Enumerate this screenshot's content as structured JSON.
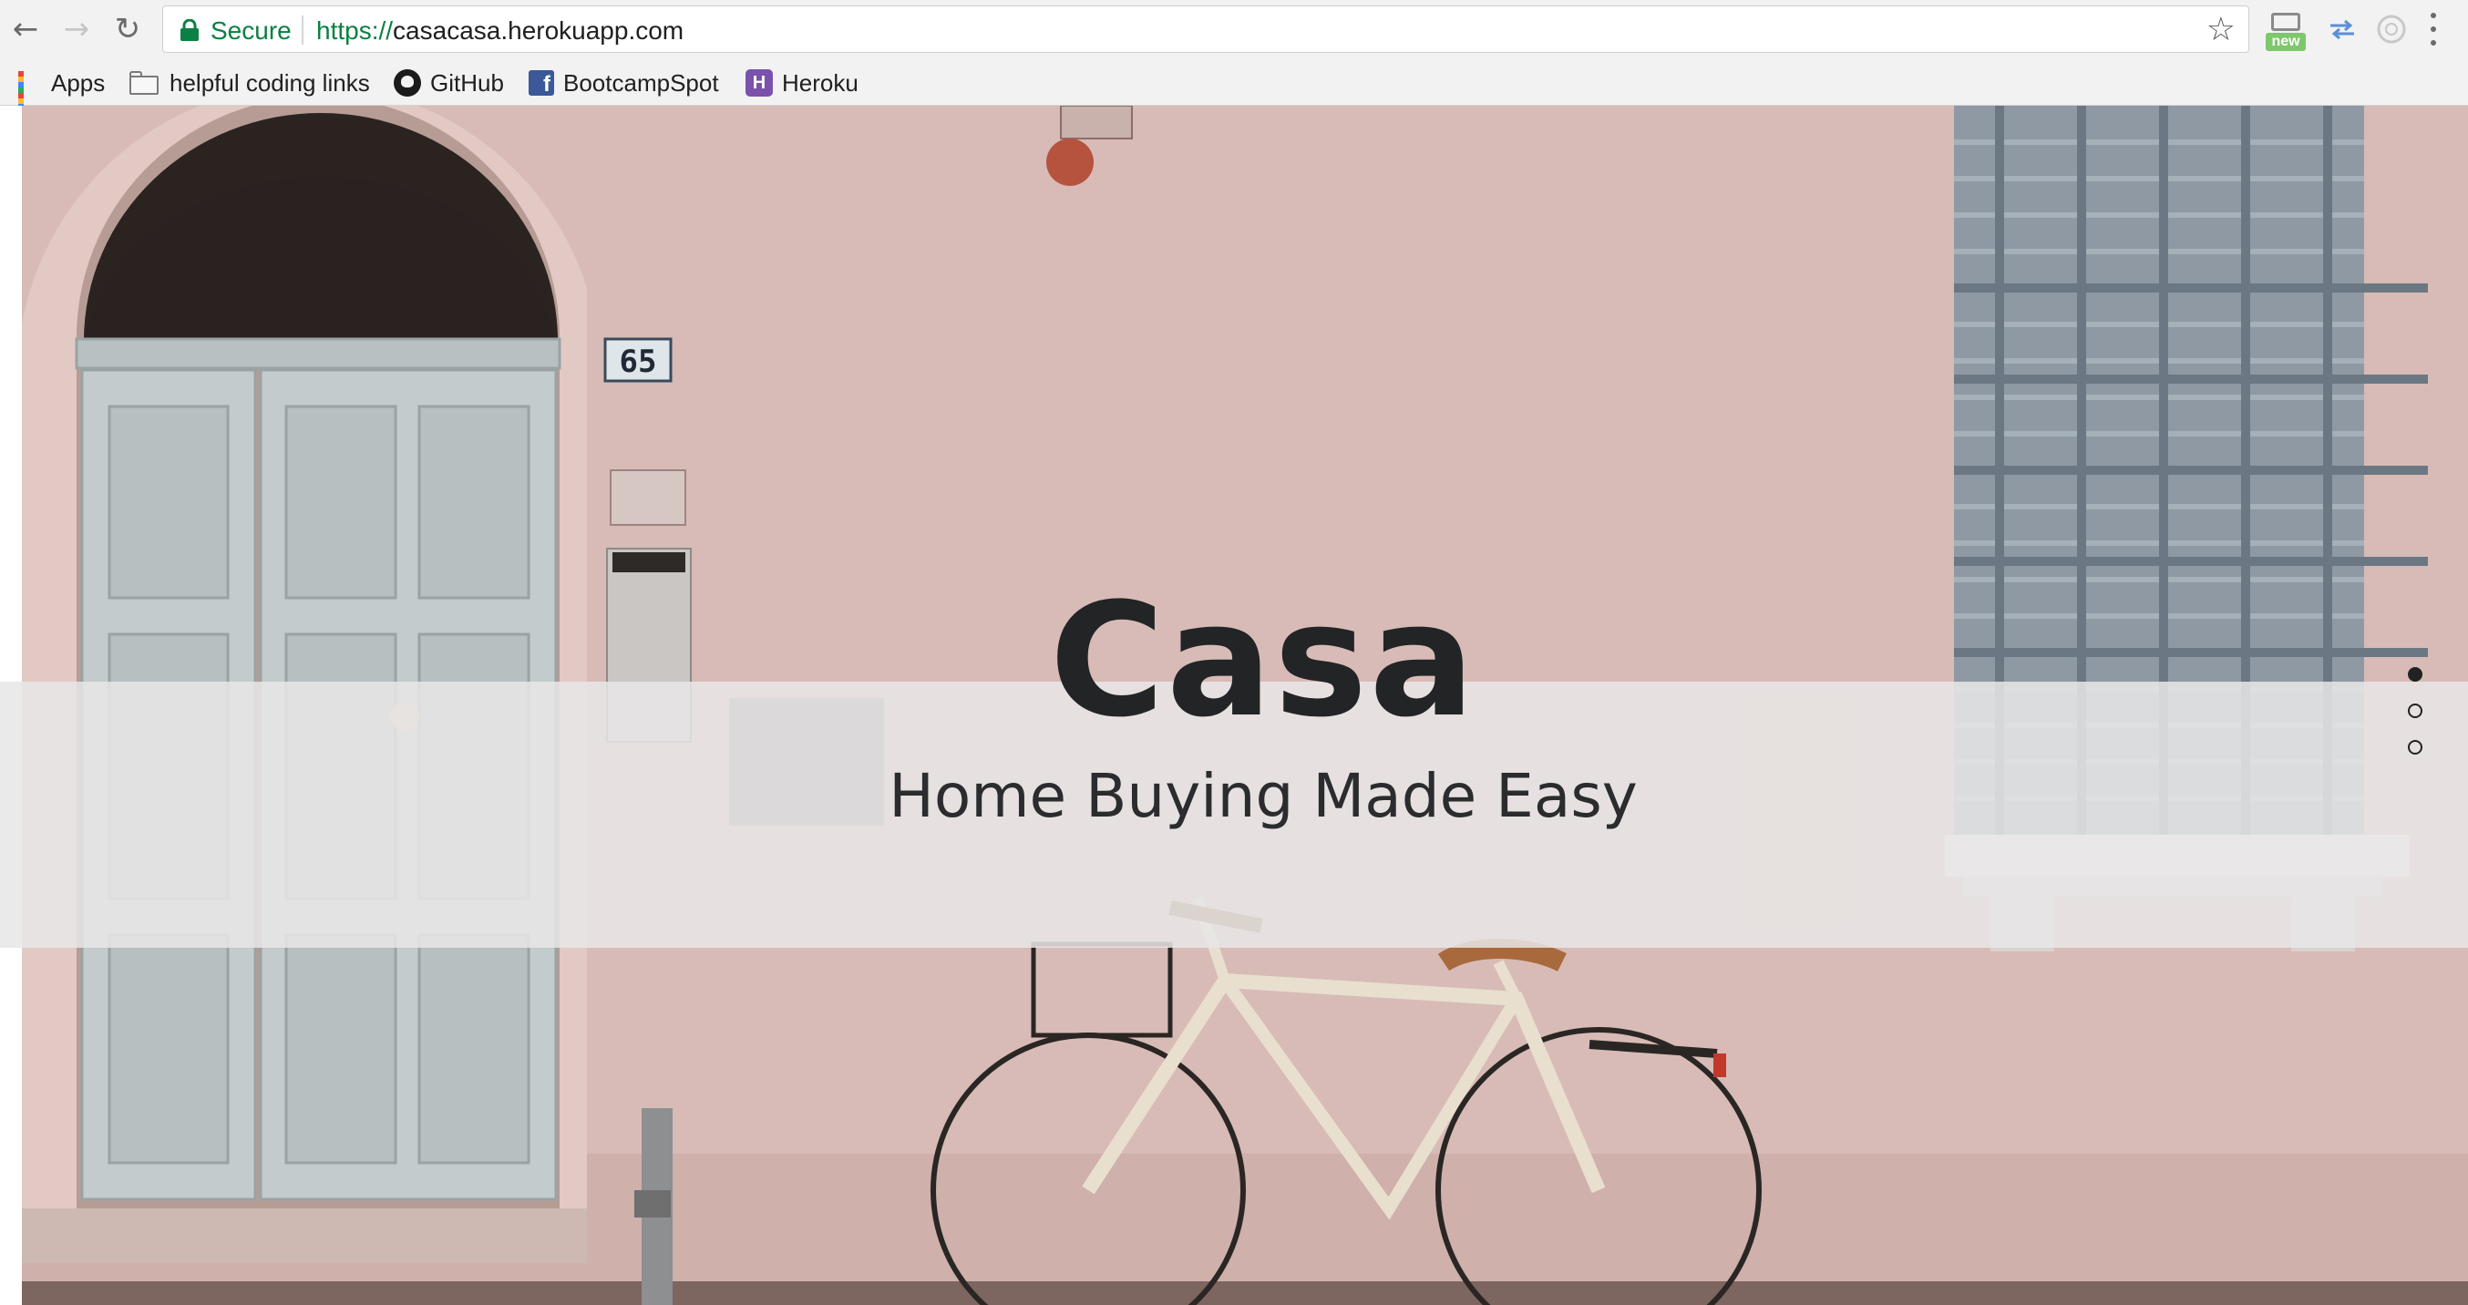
{
  "browser": {
    "secure_label": "Secure",
    "url_scheme": "https://",
    "url_rest": "casacasa.herokuapp.com",
    "new_badge": "new",
    "bookmarks": [
      {
        "label": "Apps",
        "icon": "apps-grid-icon"
      },
      {
        "label": "helpful coding links",
        "icon": "folder-icon"
      },
      {
        "label": "GitHub",
        "icon": "github-icon"
      },
      {
        "label": "BootcampSpot",
        "icon": "facebook-icon"
      },
      {
        "label": "Heroku",
        "icon": "heroku-icon"
      }
    ],
    "colors": {
      "secure": "#0b8043",
      "chrome": "#f2f2f2"
    }
  },
  "hero": {
    "title": "Casa",
    "subtitle": "Home Buying Made Easy",
    "house_number": "65",
    "slide_count": 3,
    "active_slide": 1,
    "colors": {
      "wall": "#d6b8b4",
      "banner": "#e8e6e6",
      "text": "#222426"
    }
  }
}
